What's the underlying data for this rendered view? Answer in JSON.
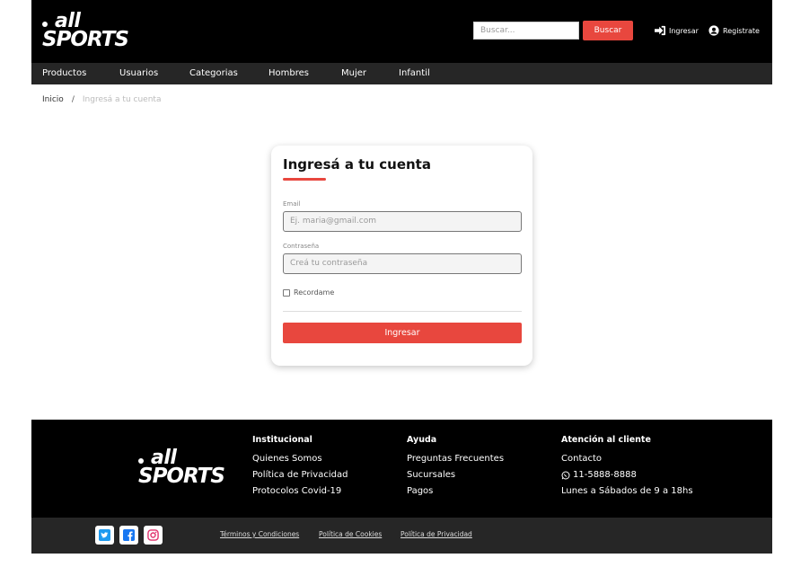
{
  "header": {
    "logo_top": "all",
    "logo_bottom": "SPORTS",
    "search_placeholder": "Buscar...",
    "search_button": "Buscar",
    "login_label": "Ingresar",
    "register_label": "Registrate"
  },
  "nav": {
    "items": [
      "Productos",
      "Usuarios",
      "Categorias",
      "Hombres",
      "Mujer",
      "Infantil"
    ]
  },
  "breadcrumb": {
    "home": "Inicio",
    "separator": "/",
    "current": "Ingresá a tu cuenta"
  },
  "login": {
    "title": "Ingresá a tu cuenta",
    "email_label": "Email",
    "email_placeholder": "Ej. maria@gmail.com",
    "password_label": "Contraseña",
    "password_placeholder": "Creá tu contraseña",
    "remember_label": "Recordame",
    "remember_checked": false,
    "submit_label": "Ingresar"
  },
  "footer": {
    "logo_top": "all",
    "logo_bottom": "SPORTS",
    "institucional": {
      "title": "Institucional",
      "links": [
        "Quienes Somos",
        "Política de Privacidad",
        "Protocolos Covid-19"
      ]
    },
    "ayuda": {
      "title": "Ayuda",
      "links": [
        "Preguntas Frecuentes",
        "Sucursales",
        "Pagos"
      ]
    },
    "atencion": {
      "title": "Atención al cliente",
      "contact": "Contacto",
      "phone": "11-5888-8888",
      "hours": "Lunes a Sábados de 9 a 18hs"
    },
    "social_icons": [
      "twitter-icon",
      "facebook-icon",
      "instagram-icon"
    ],
    "legal_links": [
      "Términos y Condiciones",
      "Política de Cookies",
      "Política de Privacidad"
    ]
  },
  "colors": {
    "accent": "#e8473e",
    "header_bg": "#000000",
    "nav_bg": "#262626"
  }
}
